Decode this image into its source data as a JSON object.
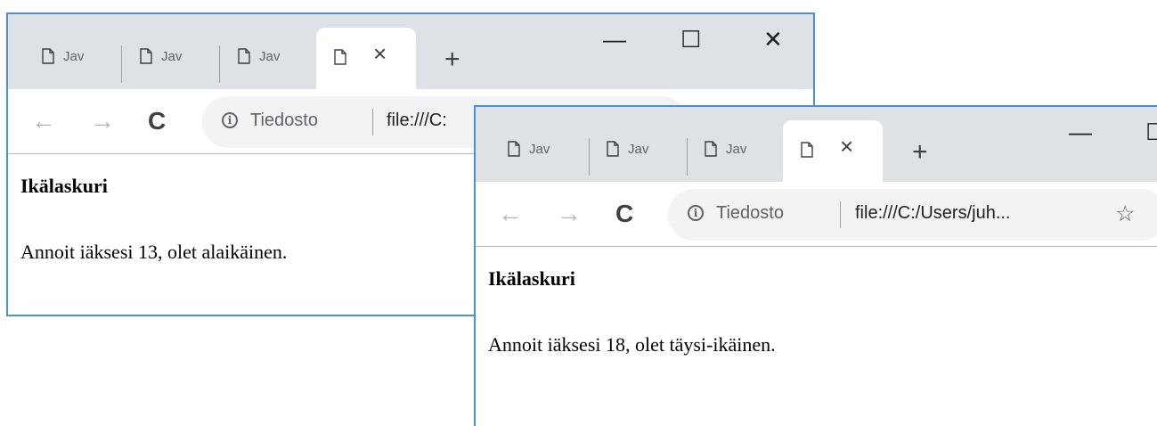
{
  "windows": [
    {
      "tabs": [
        {
          "title": "Jav"
        },
        {
          "title": "Jav"
        },
        {
          "title": "Jav"
        }
      ],
      "active_tab": {
        "close": "×"
      },
      "new_tab": "+",
      "controls": {
        "minimize": "—",
        "maximize": "☐",
        "close": "✕"
      },
      "nav": {
        "back": "←",
        "forward": "→",
        "reload": "C"
      },
      "omnibox": {
        "site_info": "Tiedosto",
        "url": "file:///C:",
        "info": "i"
      },
      "page": {
        "heading": "Ikälaskuri",
        "text": "Annoit iäksesi 13, olet alaikäinen."
      }
    },
    {
      "tabs": [
        {
          "title": "Jav"
        },
        {
          "title": "Jav"
        },
        {
          "title": "Jav"
        }
      ],
      "active_tab": {
        "close": "×"
      },
      "new_tab": "+",
      "controls": {
        "minimize": "—",
        "maximize": "☐"
      },
      "nav": {
        "back": "←",
        "forward": "→",
        "reload": "C"
      },
      "omnibox": {
        "site_info": "Tiedosto",
        "url": "file:///C:/Users/juh...",
        "star": "☆",
        "info": "i"
      },
      "page": {
        "heading": "Ikälaskuri",
        "text": "Annoit iäksesi 18, olet täysi-ikäinen."
      }
    }
  ],
  "colors": {
    "window_border": "#4a90d9",
    "tabstrip": "#dee1e6",
    "omnibox": "#f1f3f4"
  }
}
